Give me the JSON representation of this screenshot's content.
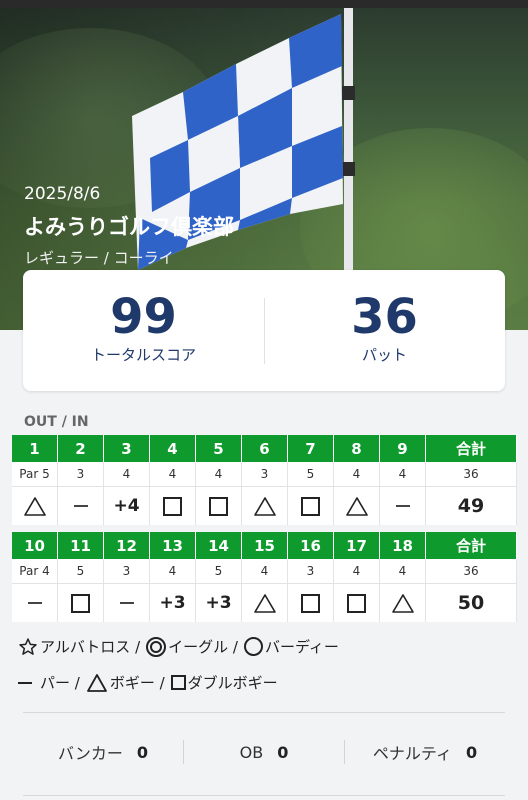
{
  "round": {
    "date": "2025/8/6",
    "club_name": "よみうりゴルフ倶楽部",
    "course": "レギュラー  / コーライ"
  },
  "summary": {
    "total_score": "99",
    "total_score_label": "トータルスコア",
    "putts": "36",
    "putts_label": "パット"
  },
  "section_label": "OUT / IN",
  "out": {
    "holes": [
      "1",
      "2",
      "3",
      "4",
      "5",
      "6",
      "7",
      "8",
      "9"
    ],
    "total_label": "合計",
    "pars": [
      "Par 5",
      "3",
      "4",
      "4",
      "4",
      "3",
      "5",
      "4",
      "4"
    ],
    "par_total": "36",
    "results": [
      "triangle",
      "dash",
      "+4",
      "square",
      "square",
      "triangle",
      "square",
      "triangle",
      "dash"
    ],
    "score_total": "49"
  },
  "in": {
    "holes": [
      "10",
      "11",
      "12",
      "13",
      "14",
      "15",
      "16",
      "17",
      "18"
    ],
    "total_label": "合計",
    "pars": [
      "Par 4",
      "5",
      "3",
      "4",
      "5",
      "4",
      "3",
      "4",
      "4"
    ],
    "par_total": "36",
    "results": [
      "dash",
      "square",
      "dash",
      "+3",
      "+3",
      "triangle",
      "square",
      "square",
      "triangle"
    ],
    "score_total": "50"
  },
  "legend": {
    "albatross": "アルバトロス /",
    "eagle": "イーグル /",
    "birdie": "バーディー",
    "par": "パー /",
    "bogey": "ボギー /",
    "double_bogey": "ダブルボギー"
  },
  "stats": {
    "bunker_label": "バンカー",
    "bunker_value": "0",
    "ob_label": "OB",
    "ob_value": "0",
    "penalty_label": "ペナルティ",
    "penalty_value": "0"
  },
  "icons": {
    "albatross": "star-outline-icon",
    "eagle": "double-circle-icon",
    "birdie": "circle-icon",
    "par": "dash-icon",
    "bogey": "triangle-icon",
    "double_bogey": "square-icon"
  },
  "colors": {
    "header_green": "#0e9a2d",
    "score_navy": "#1f3a6a",
    "flag_blue": "#2f63c8"
  }
}
